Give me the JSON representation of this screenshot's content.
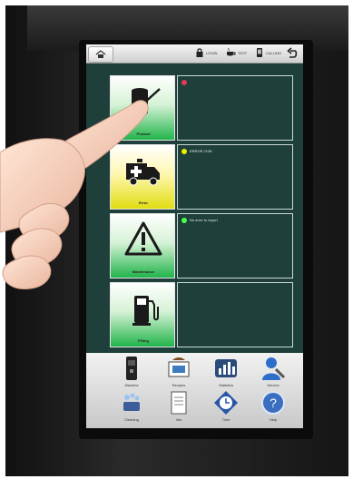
{
  "topbar": {
    "items": [
      {
        "icon": "lock-icon",
        "label": "LOGIN"
      },
      {
        "icon": "cup-icon",
        "label": "TEST"
      },
      {
        "icon": "phone-icon",
        "label": "CALLING"
      }
    ]
  },
  "rows": [
    {
      "tile_label": "Product",
      "tile_color": "green",
      "status_dot_color": "#e53a57",
      "message": ""
    },
    {
      "tile_label": "Error",
      "tile_color": "yellow",
      "status_dot_color": "#e8f000",
      "message": "ERROR 2136"
    },
    {
      "tile_label": "Maintenance",
      "tile_color": "green",
      "status_dot_color": "#4cff4c",
      "message": "No error to report"
    },
    {
      "tile_label": "Filling",
      "tile_color": "green",
      "status_dot_color": "",
      "message": ""
    }
  ],
  "dock": {
    "row1": [
      {
        "icon": "machine-icon",
        "label": "Machine"
      },
      {
        "icon": "recipes-icon",
        "label": "Recipes"
      },
      {
        "icon": "statistics-icon",
        "label": "Statistics"
      },
      {
        "icon": "service-icon",
        "label": "Service"
      }
    ],
    "row2": [
      {
        "icon": "cleaning-icon",
        "label": "Cleaning"
      },
      {
        "icon": "notes-icon",
        "label": "Info"
      },
      {
        "icon": "time-icon",
        "label": "Time"
      },
      {
        "icon": "help-icon",
        "label": "Help"
      }
    ]
  }
}
